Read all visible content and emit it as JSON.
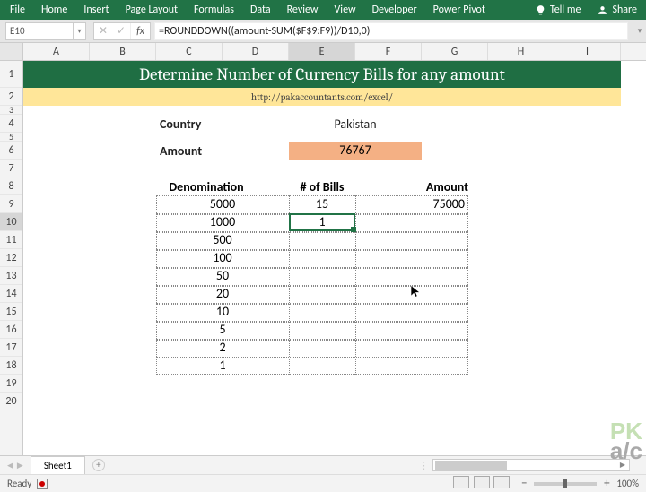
{
  "ribbon": {
    "tabs": [
      "File",
      "Home",
      "Insert",
      "Page Layout",
      "Formulas",
      "Data",
      "Review",
      "View",
      "Developer",
      "Power Pivot"
    ],
    "tell_me": "Tell me",
    "share": "Share"
  },
  "name_box": "E10",
  "formula_bar": "=ROUNDDOWN((amount-SUM($F$9:F9))/D10,0)",
  "columns": [
    "A",
    "B",
    "C",
    "D",
    "E",
    "F",
    "G",
    "H",
    "I"
  ],
  "sheet": {
    "title": "Determine Number of Currency Bills for any amount",
    "link": "http://pakaccountants.com/excel/",
    "country_label": "Country",
    "country_value": "Pakistan",
    "amount_label": "Amount",
    "amount_value": "76767",
    "headers": {
      "denom": "Denomination",
      "bills": "# of Bills",
      "amount": "Amount"
    },
    "rows": [
      {
        "denom": "5000",
        "bills": "15",
        "amount": "75000"
      },
      {
        "denom": "1000",
        "bills": "1",
        "amount": ""
      },
      {
        "denom": "500",
        "bills": "",
        "amount": ""
      },
      {
        "denom": "100",
        "bills": "",
        "amount": ""
      },
      {
        "denom": "50",
        "bills": "",
        "amount": ""
      },
      {
        "denom": "20",
        "bills": "",
        "amount": ""
      },
      {
        "denom": "10",
        "bills": "",
        "amount": ""
      },
      {
        "denom": "5",
        "bills": "",
        "amount": ""
      },
      {
        "denom": "2",
        "bills": "",
        "amount": ""
      },
      {
        "denom": "1",
        "bills": "",
        "amount": ""
      }
    ]
  },
  "watermark": {
    "top": "PK",
    "bot": "a/c"
  },
  "sheet_tab": "Sheet1",
  "status": {
    "ready": "Ready",
    "zoom": "100%"
  },
  "chart_data": {
    "type": "table",
    "title": "Determine Number of Currency Bills for any amount",
    "country": "Pakistan",
    "amount": 76767,
    "columns": [
      "Denomination",
      "# of Bills",
      "Amount"
    ],
    "rows": [
      [
        5000,
        15,
        75000
      ],
      [
        1000,
        1,
        null
      ],
      [
        500,
        null,
        null
      ],
      [
        100,
        null,
        null
      ],
      [
        50,
        null,
        null
      ],
      [
        20,
        null,
        null
      ],
      [
        10,
        null,
        null
      ],
      [
        5,
        null,
        null
      ],
      [
        2,
        null,
        null
      ],
      [
        1,
        null,
        null
      ]
    ]
  }
}
